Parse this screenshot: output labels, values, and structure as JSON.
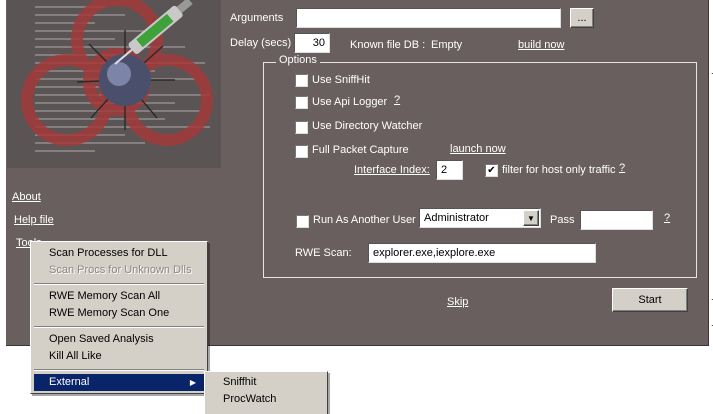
{
  "form": {
    "arguments_label": "Arguments",
    "arguments_value": "",
    "browse_label": "...",
    "delay_label": "Delay (secs)",
    "delay_value": "30",
    "known_db_label": "Known file DB :",
    "known_db_value": "Empty",
    "build_now_label": "build now"
  },
  "options": {
    "title": "Options",
    "use_sniffhit": "Use SniffHit",
    "use_api_logger": "Use Api Logger",
    "api_help": "?",
    "use_directory_watcher": "Use Directory Watcher",
    "full_packet_capture": "Full Packet Capture",
    "launch_now_label": "launch now",
    "interface_index_label": "Interface Index:",
    "interface_index_value": "2",
    "filter_host_label": "filter for host only traffic",
    "filter_help": "?",
    "run_as_label": "Run As Another User",
    "run_as_value": "Administrator",
    "pass_label": "Pass",
    "pass_value": "",
    "pass_help": "?",
    "rwe_scan_label": "RWE Scan:",
    "rwe_scan_value": "explorer.exe,iexplore.exe"
  },
  "footer": {
    "skip_label": "Skip",
    "start_label": "Start"
  },
  "left_links": {
    "about": "About",
    "help_file": "Help file",
    "tools": "Tools"
  },
  "tools_menu": {
    "items": [
      "Scan Processes for DLL",
      "Scan Procs for Unknown Dlls",
      "RWE Memory Scan All",
      "RWE Memory Scan One",
      "Open Saved Analysis",
      "Kill All Like",
      "External"
    ]
  },
  "external_menu": {
    "items": [
      "Sniffhit",
      "ProcWatch"
    ]
  },
  "checkbox_states": {
    "use_sniffhit": false,
    "use_api_logger": false,
    "use_directory_watcher": false,
    "full_packet_capture": false,
    "filter_host": true,
    "run_as": false
  },
  "colors": {
    "panel": "#6a5f5f",
    "menu": "#d4d0c8",
    "menu_highlight": "#0a246a",
    "biohazard": "#a33a3a"
  }
}
